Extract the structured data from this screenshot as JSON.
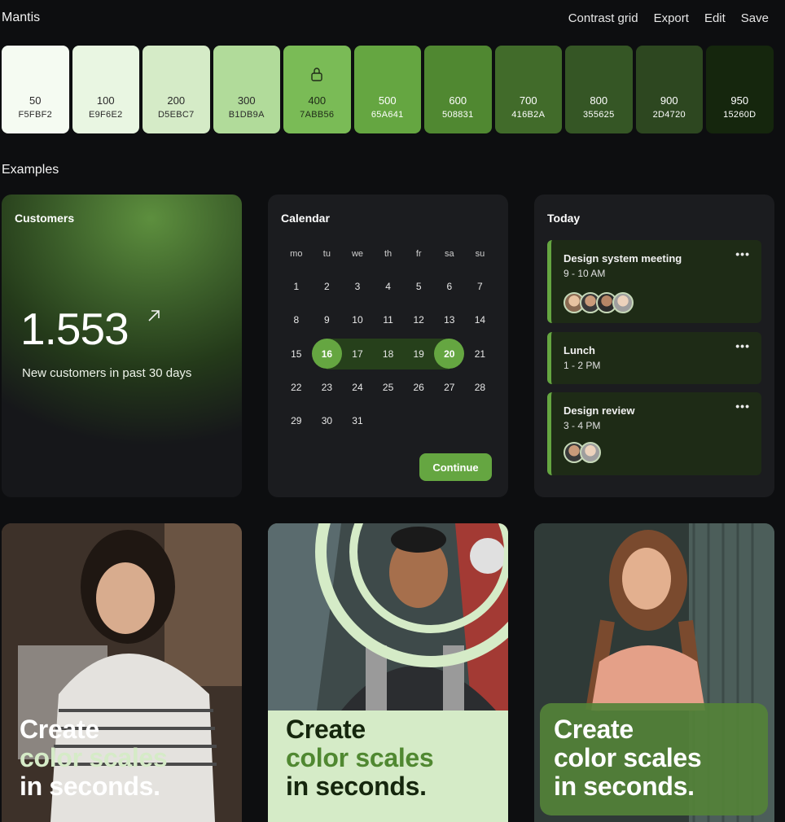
{
  "app": {
    "title": "Mantis"
  },
  "actions": [
    "Contrast grid",
    "Export",
    "Edit",
    "Save"
  ],
  "swatches": [
    {
      "step": "50",
      "hex": "F5FBF2",
      "bg": "#F5FBF2",
      "fg": "#2a2a2a"
    },
    {
      "step": "100",
      "hex": "E9F6E2",
      "bg": "#E9F6E2",
      "fg": "#2a2a2a"
    },
    {
      "step": "200",
      "hex": "D5EBC7",
      "bg": "#D5EBC7",
      "fg": "#2a2a2a"
    },
    {
      "step": "300",
      "hex": "B1DB9A",
      "bg": "#B1DB9A",
      "fg": "#2a2a2a"
    },
    {
      "step": "400",
      "hex": "7ABB56",
      "bg": "#7ABB56",
      "fg": "#1f2a18",
      "locked": true
    },
    {
      "step": "500",
      "hex": "65A641",
      "bg": "#65A641",
      "fg": "#ffffff"
    },
    {
      "step": "600",
      "hex": "508831",
      "bg": "#508831",
      "fg": "#ffffff"
    },
    {
      "step": "700",
      "hex": "416B2A",
      "bg": "#416B2A",
      "fg": "#ffffff"
    },
    {
      "step": "800",
      "hex": "355625",
      "bg": "#355625",
      "fg": "#ffffff"
    },
    {
      "step": "900",
      "hex": "2D4720",
      "bg": "#2D4720",
      "fg": "#ffffff"
    },
    {
      "step": "950",
      "hex": "15260D",
      "bg": "#15260D",
      "fg": "#ffffff"
    }
  ],
  "examples_title": "Examples",
  "customers": {
    "title": "Customers",
    "value": "1.553",
    "subtitle": "New customers in past 30 days"
  },
  "calendar": {
    "title": "Calendar",
    "weekdays": [
      "mo",
      "tu",
      "we",
      "th",
      "fr",
      "sa",
      "su"
    ],
    "weeks": [
      [
        "1",
        "2",
        "3",
        "4",
        "5",
        "6",
        "7"
      ],
      [
        "8",
        "9",
        "10",
        "11",
        "12",
        "13",
        "14"
      ],
      [
        "15",
        "16",
        "17",
        "18",
        "19",
        "20",
        "21"
      ],
      [
        "22",
        "23",
        "24",
        "25",
        "26",
        "27",
        "28"
      ],
      [
        "29",
        "30",
        "31"
      ]
    ],
    "range_start": "16",
    "range_end": "20",
    "continue_label": "Continue"
  },
  "today": {
    "title": "Today",
    "events": [
      {
        "title": "Design system meeting",
        "time": "9 - 10 AM",
        "more": "•••",
        "attendees": 4
      },
      {
        "title": "Lunch",
        "time": "1 - 2 PM",
        "more": "•••",
        "attendees": 0
      },
      {
        "title": "Design review",
        "time": "3 - 4 PM",
        "more": "•••",
        "attendees": 2
      }
    ]
  },
  "promos": [
    {
      "line1": "Create",
      "line2": "color scales",
      "line3": "in seconds."
    },
    {
      "line1": "Create",
      "line2": "color scales",
      "line3": "in seconds."
    },
    {
      "line1": "Create",
      "line2": "color scales",
      "line3": "in seconds."
    }
  ],
  "colors": {
    "accent": "#65A641",
    "background": "#0d0e10",
    "card": "#1b1c1f"
  }
}
